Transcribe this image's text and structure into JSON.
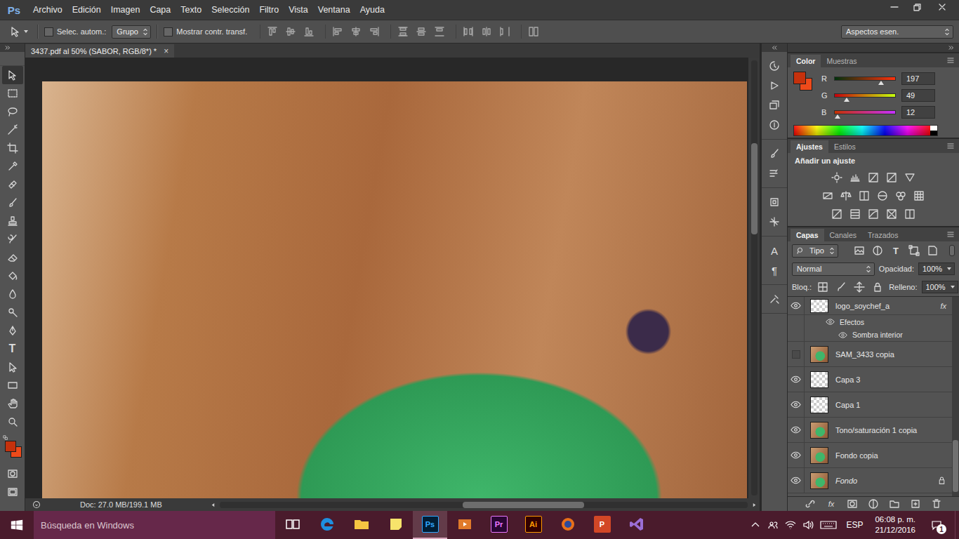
{
  "app": {
    "logo": "Ps"
  },
  "menu": [
    "Archivo",
    "Edición",
    "Imagen",
    "Capa",
    "Texto",
    "Selección",
    "Filtro",
    "Vista",
    "Ventana",
    "Ayuda"
  ],
  "options_bar": {
    "auto_select": {
      "label": "Selec. autom.:",
      "checked": false
    },
    "auto_select_target": "Grupo",
    "show_transform": {
      "label": "Mostrar contr. transf.",
      "checked": false
    },
    "workspace": "Aspectos esen."
  },
  "document": {
    "tab": "3437.pdf al 50% (SABOR, RGB/8*) *",
    "close": "×",
    "status": "Doc: 27.0 MB/199.1 MB",
    "vertical_scroll": {
      "start": 0.19,
      "size": 0.21
    },
    "horizontal_scroll": {
      "start": 0.46,
      "size": 0.23
    }
  },
  "toolbar": {
    "tools": [
      {
        "selected": true
      },
      {
        "selected": false
      },
      {
        "selected": false
      },
      {
        "selected": false
      },
      {
        "selected": false
      },
      {
        "selected": false
      },
      {
        "selected": false
      },
      {
        "selected": false
      },
      {
        "selected": false
      },
      {
        "selected": false
      },
      {
        "selected": false
      },
      {
        "selected": false
      },
      {
        "selected": false
      },
      {
        "selected": false
      },
      {
        "selected": false
      },
      {
        "selected": false,
        "glyph": "T"
      },
      {
        "selected": false
      },
      {
        "selected": false
      },
      {
        "selected": false
      },
      {
        "selected": false
      }
    ],
    "foreground": "#c5310c",
    "background": "#ee4a1a"
  },
  "dock": {
    "character": "A",
    "paragraph": "¶"
  },
  "color_panel": {
    "tabs": [
      {
        "label": "Color",
        "selected": true
      },
      {
        "label": "Muestras",
        "selected": false
      }
    ],
    "channels": [
      {
        "name": "R",
        "value": "197",
        "level": 0.773,
        "from": "#00310c",
        "to": "#ff310c"
      },
      {
        "name": "G",
        "value": "49",
        "level": 0.192,
        "from": "#c5000c",
        "to": "#c5ff0c"
      },
      {
        "name": "B",
        "value": "12",
        "level": 0.047,
        "from": "#c53100",
        "to": "#c531ff"
      }
    ]
  },
  "adjustments_panel": {
    "tabs": [
      {
        "label": "Ajustes",
        "selected": true
      },
      {
        "label": "Estilos",
        "selected": false
      }
    ],
    "title": "Añadir un ajuste"
  },
  "layers_panel": {
    "tabs": [
      {
        "label": "Capas",
        "selected": true
      },
      {
        "label": "Canales",
        "selected": false
      },
      {
        "label": "Trazados",
        "selected": false
      }
    ],
    "filter": "Tipo",
    "text_filter_icon": "T",
    "blend_mode": "Normal",
    "opacity_label": "Opacidad:",
    "opacity": "100%",
    "lock_label": "Bloq.:",
    "fill_label": "Relleno:",
    "fill": "100%",
    "fx_button": "fx",
    "scroll": {
      "start": 0.72,
      "size": 0.26
    },
    "layers": [
      {
        "kind": "layer",
        "name": "logo_soychef_a",
        "visible": true,
        "thumb": "transparent",
        "fx": "fx",
        "selected": false
      },
      {
        "kind": "effects",
        "name": "Efectos",
        "visible": true,
        "selected": false
      },
      {
        "kind": "effect",
        "name": "Sombra interior",
        "visible": true,
        "selected": false
      },
      {
        "kind": "layer",
        "name": "SAM_3433 copia",
        "visible": false,
        "thumb": "image",
        "selected": false
      },
      {
        "kind": "layer",
        "name": "Capa 3",
        "visible": true,
        "thumb": "transparent",
        "selected": false
      },
      {
        "kind": "layer",
        "name": "Capa 1",
        "visible": true,
        "thumb": "transparent",
        "selected": false
      },
      {
        "kind": "layer",
        "name": "Tono/saturación 1 copia",
        "visible": true,
        "thumb": "image",
        "selected": false
      },
      {
        "kind": "layer",
        "name": "Fondo copia",
        "visible": true,
        "thumb": "image",
        "selected": false
      },
      {
        "kind": "layer",
        "name": "Fondo",
        "visible": true,
        "thumb": "image",
        "locked": true,
        "selected": false
      }
    ]
  },
  "taskbar": {
    "search": "Búsqueda en Windows",
    "apps": [
      {
        "active": false
      },
      {
        "active": false
      },
      {
        "active": false
      },
      {
        "active": false
      },
      {
        "label": "Ps",
        "active": true
      },
      {
        "active": false
      },
      {
        "label": "Pr",
        "active": false
      },
      {
        "label": "Ai",
        "active": false
      },
      {
        "active": false
      },
      {
        "label": "P",
        "active": false
      },
      {
        "active": false
      }
    ],
    "language": "ESP",
    "time": "06:08 p. m.",
    "date": "21/12/2016",
    "notifications": "1"
  }
}
